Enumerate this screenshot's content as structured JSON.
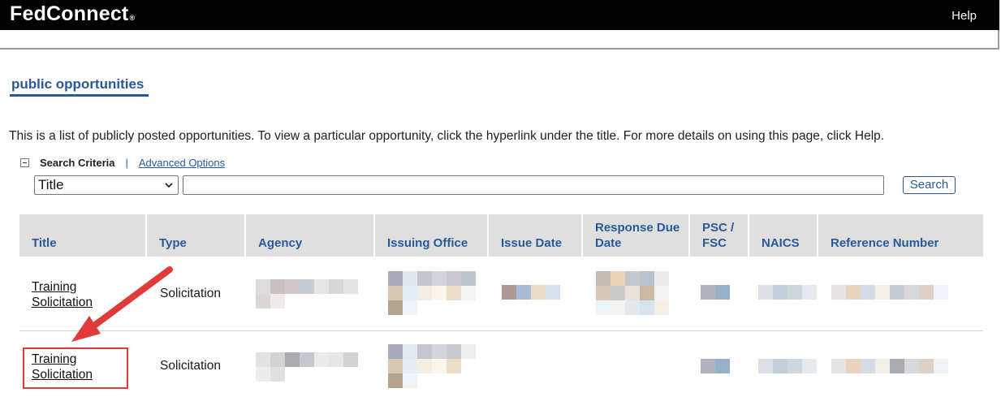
{
  "header": {
    "logo_text": "FedConnect",
    "logo_mark": "®",
    "help_label": "Help"
  },
  "page": {
    "section_title": "public opportunities",
    "intro_text": "This is a list of publicly posted opportunities. To view a particular opportunity, click the hyperlink under the title. For more details on using this page, click Help."
  },
  "search": {
    "criteria_label": "Search Criteria",
    "separator": "|",
    "advanced_label": "Advanced Options",
    "field_selected": "Title",
    "query_value": "",
    "button_label": "Search"
  },
  "table": {
    "columns": [
      "Title",
      "Type",
      "Agency",
      "Issuing Office",
      "Issue Date",
      "Response Due Date",
      "PSC / FSC",
      "NAICS",
      "Reference Number"
    ],
    "rows": [
      {
        "title_line1": "Training",
        "title_line2": "Solicitation",
        "type": "Solicitation"
      },
      {
        "title_line1": "Training",
        "title_line2": "Solicitation",
        "type": "Solicitation"
      }
    ]
  },
  "colors": {
    "accent": "#2a5a96",
    "highlight": "#e03a3a",
    "header_bg": "#000000",
    "table_header_bg": "#dfdfdf"
  },
  "icons": {
    "collapse": "minus-square-icon",
    "select_chevron": "chevron-down-icon",
    "annotation": "red-arrow-icon"
  }
}
